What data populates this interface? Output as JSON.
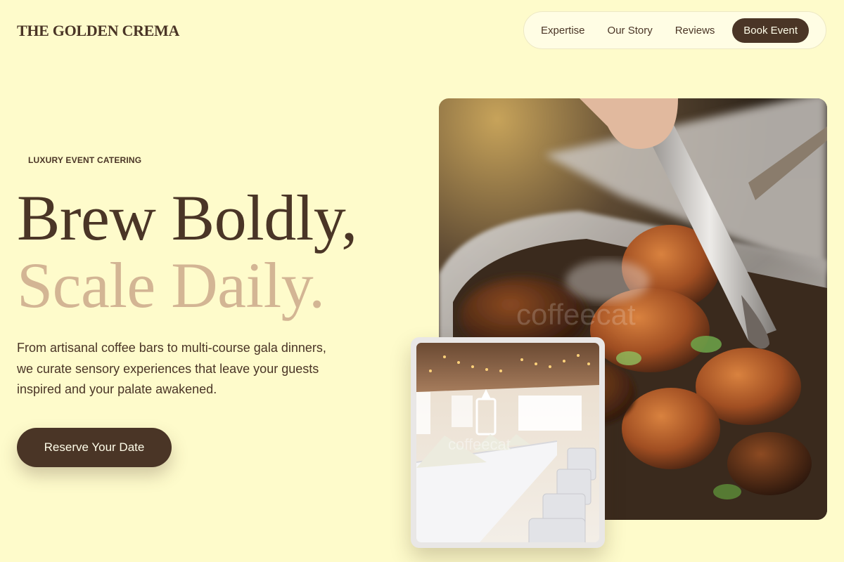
{
  "brand": {
    "name": "THE GOLDEN CREMA"
  },
  "nav": {
    "links": [
      "Expertise",
      "Our Story",
      "Reviews"
    ],
    "cta": "Book Event"
  },
  "hero": {
    "eyebrow": "LUXURY EVENT CATERING",
    "headline_line1": "Brew Boldly,",
    "headline_line2": "Scale Daily.",
    "lede": "From artisanal coffee bars to multi-course gala dinners, we curate sensory experiences that leave your guests inspired and your palate awakened.",
    "cta": "Reserve Your Date"
  },
  "images": {
    "main_watermark": "coffeecat",
    "inset_watermark": "coffeecat"
  },
  "colors": {
    "background": "#FEFBCB",
    "primary": "#4A3526",
    "accent": "#D3B594",
    "nav_bg": "#FFFDE4"
  }
}
